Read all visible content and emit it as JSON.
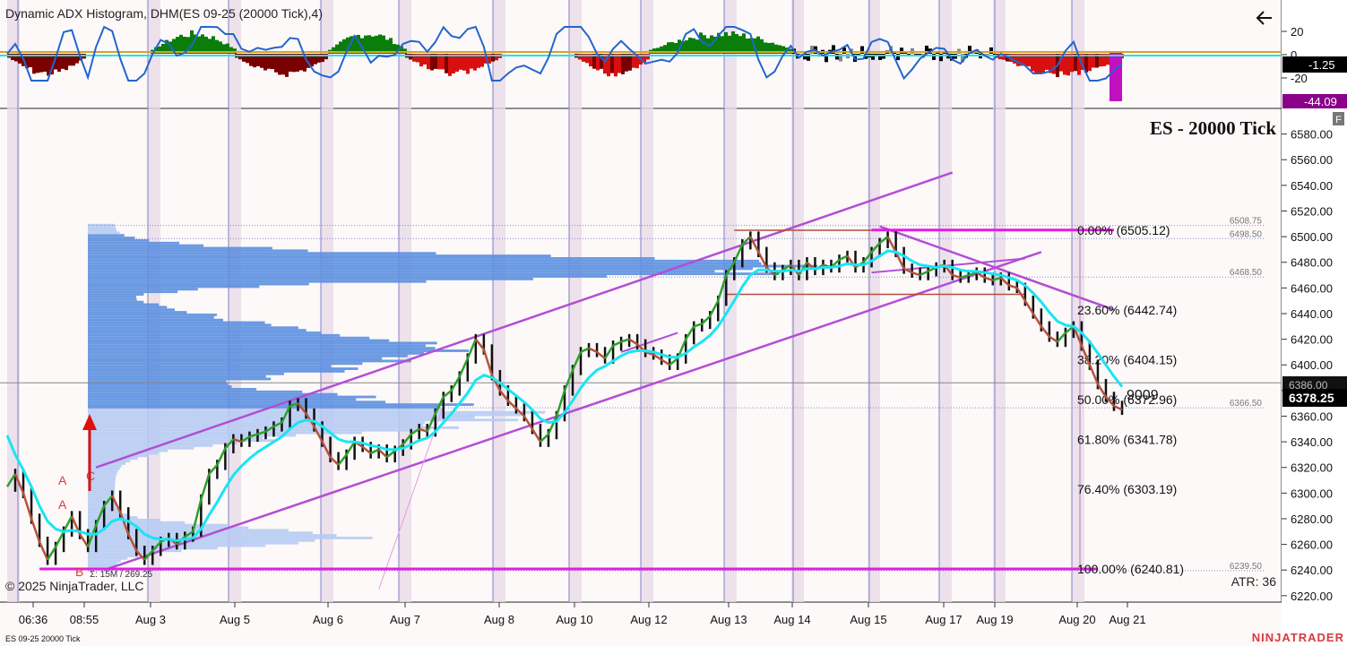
{
  "indicator_title": "Dynamic ADX Histogram, DHM(ES 09-25 (20000 Tick),4)",
  "back_arrow_icon": "arrow-left-icon",
  "panel_icon_label": "F",
  "instrument_title": "ES - 20000 Tick",
  "copyright": "© 2025 NinjaTrader, LLC",
  "atr_label": "ATR: 36",
  "footer_instrument": "ES 09-25 20000 Tick",
  "brand": "NINJATRADER",
  "annotation_9009": "9009",
  "volume_note": "Σ: 15M / 269.25",
  "abc_labels": [
    "A",
    "A",
    "B",
    "C"
  ],
  "colors": {
    "bull": "#2ea02e",
    "bear": "#b5533e",
    "ema": "#19e5f2",
    "channel": "#b34dd6",
    "fib_line": "#e21ce2",
    "volume_profile": "#5b8fe0",
    "hist_green": "#0b7d0b",
    "hist_red": "#d81010",
    "hist_darkred": "#7a0000",
    "price_badge": "#000000",
    "adx_badge": "#8a008a"
  },
  "chart_data": [
    {
      "type": "bar",
      "title": "Dynamic ADX Histogram, DHM(ES 09-25 (20000 Tick),4)",
      "ylim": [
        -30,
        30
      ],
      "yticks": [
        "20",
        "0",
        "-20"
      ],
      "last_value_labels": [
        "-1.25",
        "-44.09"
      ],
      "segments": [
        {
          "from": "06:36",
          "to": "08:55",
          "direction": "down",
          "color": "darkred"
        },
        {
          "from": "Aug 3",
          "to": "Aug 5",
          "direction": "up",
          "color": "green"
        },
        {
          "from": "Aug 5",
          "to": "Aug 6",
          "direction": "down",
          "color": "darkred"
        },
        {
          "from": "Aug 6",
          "to": "Aug 7",
          "direction": "up",
          "color": "green"
        },
        {
          "from": "Aug 7",
          "to": "Aug 8",
          "direction": "down",
          "color": "red"
        },
        {
          "from": "Aug 10",
          "to": "Aug 12",
          "direction": "down",
          "color": "red"
        },
        {
          "from": "Aug 12",
          "to": "Aug 14",
          "direction": "up",
          "color": "green"
        },
        {
          "from": "Aug 14",
          "to": "Aug 19",
          "direction": "mixed",
          "color": "black"
        },
        {
          "from": "Aug 19",
          "to": "Aug 21",
          "direction": "down",
          "color": "red"
        }
      ]
    },
    {
      "type": "line",
      "title": "ES - 20000 Tick",
      "ylim": [
        6215,
        6600
      ],
      "yticks": [
        6220,
        6240,
        6260,
        6280,
        6300,
        6320,
        6340,
        6360,
        6380,
        6400,
        6420,
        6440,
        6460,
        6480,
        6500,
        6520,
        6540,
        6560,
        6580
      ],
      "xticks": [
        "06:36",
        "08:55",
        "Aug 3",
        "Aug 5",
        "Aug 6",
        "Aug 7",
        "Aug 8",
        "Aug 10",
        "Aug 12",
        "Aug 13",
        "Aug 14",
        "Aug 15",
        "Aug 17",
        "Aug 19",
        "Aug 20",
        "Aug 21"
      ],
      "last_price": "6378.25",
      "hidden_price_badge": "6386.00",
      "price_series": [
        6305,
        6315,
        6300,
        6280,
        6262,
        6248,
        6258,
        6270,
        6282,
        6268,
        6258,
        6275,
        6290,
        6298,
        6285,
        6268,
        6255,
        6248,
        6255,
        6262,
        6265,
        6260,
        6266,
        6270,
        6295,
        6315,
        6322,
        6335,
        6342,
        6340,
        6344,
        6346,
        6348,
        6352,
        6355,
        6368,
        6370,
        6362,
        6352,
        6340,
        6328,
        6322,
        6330,
        6340,
        6336,
        6331,
        6334,
        6328,
        6333,
        6338,
        6346,
        6350,
        6348,
        6362,
        6375,
        6380,
        6391,
        6405,
        6420,
        6412,
        6392,
        6380,
        6372,
        6366,
        6360,
        6350,
        6340,
        6346,
        6360,
        6380,
        6396,
        6410,
        6413,
        6410,
        6405,
        6415,
        6418,
        6420,
        6416,
        6410,
        6408,
        6404,
        6400,
        6405,
        6420,
        6430,
        6432,
        6438,
        6450,
        6470,
        6480,
        6494,
        6500,
        6488,
        6476,
        6470,
        6474,
        6478,
        6470,
        6480,
        6474,
        6478,
        6476,
        6482,
        6485,
        6476,
        6480,
        6488,
        6495,
        6500,
        6488,
        6475,
        6472,
        6470,
        6473,
        6476,
        6478,
        6470,
        6468,
        6470,
        6472,
        6468,
        6466,
        6468,
        6462,
        6460,
        6450,
        6440,
        6430,
        6422,
        6418,
        6425,
        6430,
        6415,
        6400,
        6385,
        6375,
        6368,
        6365
      ],
      "ema_series": [
        6345,
        6330,
        6318,
        6305,
        6290,
        6278,
        6272,
        6270,
        6271,
        6270,
        6268,
        6268,
        6272,
        6278,
        6280,
        6278,
        6274,
        6268,
        6265,
        6264,
        6264,
        6263,
        6264,
        6265,
        6272,
        6283,
        6293,
        6304,
        6314,
        6321,
        6327,
        6332,
        6336,
        6340,
        6344,
        6350,
        6355,
        6357,
        6356,
        6352,
        6347,
        6342,
        6340,
        6340,
        6339,
        6337,
        6336,
        6334,
        6334,
        6335,
        6338,
        6341,
        6343,
        6348,
        6355,
        6362,
        6370,
        6378,
        6388,
        6392,
        6390,
        6386,
        6381,
        6376,
        6371,
        6365,
        6358,
        6355,
        6356,
        6363,
        6372,
        6382,
        6390,
        6396,
        6399,
        6403,
        6407,
        6410,
        6411,
        6411,
        6410,
        6408,
        6406,
        6406,
        6409,
        6414,
        6418,
        6423,
        6430,
        6440,
        6450,
        6461,
        6470,
        6474,
        6474,
        6473,
        6473,
        6474,
        6473,
        6475,
        6475,
        6476,
        6476,
        6477,
        6479,
        6478,
        6478,
        6481,
        6485,
        6489,
        6488,
        6485,
        6481,
        6478,
        6477,
        6476,
        6477,
        6476,
        6474,
        6473,
        6473,
        6472,
        6471,
        6470,
        6468,
        6466,
        6462,
        6456,
        6449,
        6441,
        6434,
        6431,
        6430,
        6425,
        6418,
        6409,
        6400,
        6391,
        6383
      ],
      "fib_levels": [
        {
          "label": "0.00% (6505.12)",
          "value": 6505.12
        },
        {
          "label": "23.60% (6442.74)",
          "value": 6442.74
        },
        {
          "label": "38.20% (6404.15)",
          "value": 6404.15
        },
        {
          "label": "50.00% (6372.96)",
          "value": 6372.96
        },
        {
          "label": "61.80% (6341.78)",
          "value": 6341.78
        },
        {
          "label": "76.40% (6303.19)",
          "value": 6303.19
        },
        {
          "label": "100.00% (6240.81)",
          "value": 6240.81
        }
      ],
      "level_labels": [
        {
          "label": "6508.75",
          "value": 6508.75
        },
        {
          "label": "6498.50",
          "value": 6498.5
        },
        {
          "label": "6468.50",
          "value": 6468.5
        },
        {
          "label": "6366.50",
          "value": 6366.5
        },
        {
          "label": "6239.50",
          "value": 6239.5
        }
      ]
    }
  ]
}
